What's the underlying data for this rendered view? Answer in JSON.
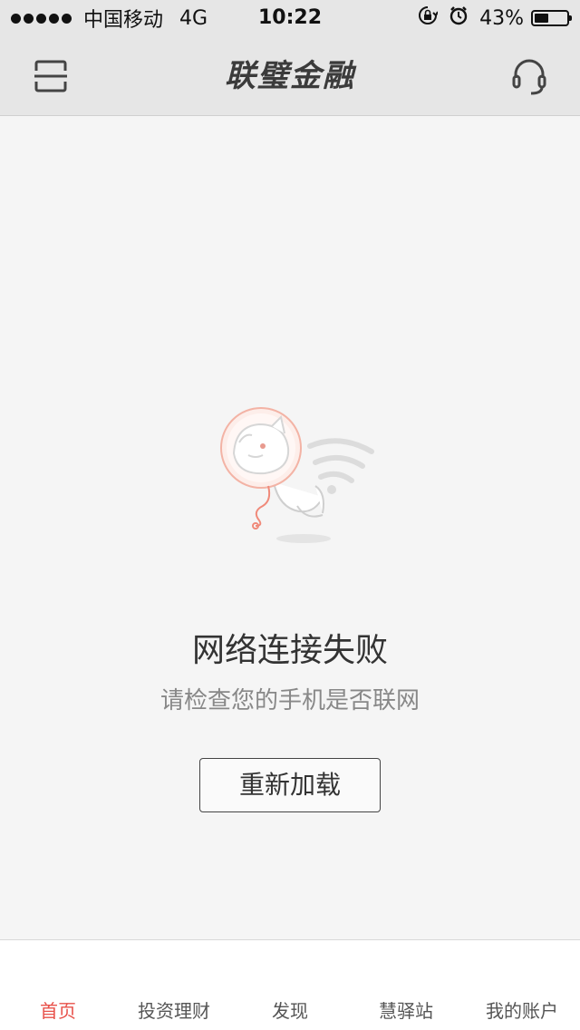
{
  "status_bar": {
    "carrier": "中国移动",
    "network": "4G",
    "time": "10:22",
    "battery_percent": "43%",
    "battery_level": 0.43,
    "icons": [
      "signal-dots-icon",
      "rotation-lock-icon",
      "alarm-icon",
      "battery-icon"
    ]
  },
  "nav": {
    "title": "联璧金融",
    "left_icon": "scan-icon",
    "right_icon": "headset-icon"
  },
  "error": {
    "title": "网络连接失败",
    "subtitle": "请检查您的手机是否联网",
    "reload_label": "重新加载",
    "illustration": "floating-astronaut-cat-illustration"
  },
  "tabs": [
    {
      "label": "首页",
      "active": true
    },
    {
      "label": "投资理财",
      "active": false
    },
    {
      "label": "发现",
      "active": false
    },
    {
      "label": "慧驿站",
      "active": false
    },
    {
      "label": "我的账户",
      "active": false
    }
  ],
  "colors": {
    "accent": "#e8514a",
    "bar_background": "#e6e6e6",
    "page_background": "#f5f5f5"
  }
}
